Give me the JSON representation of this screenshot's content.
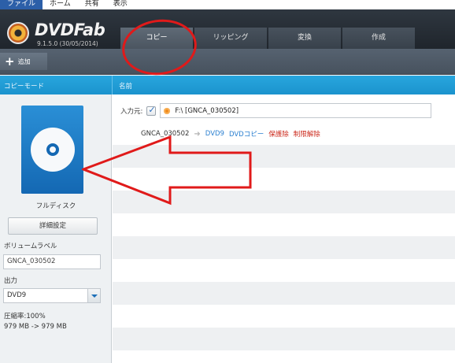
{
  "menu": {
    "items": [
      "ファイル",
      "ホーム",
      "共有",
      "表示"
    ]
  },
  "app": {
    "logo_text": "DVDFab",
    "version": "9.1.5.0 (30/05/2014)"
  },
  "tabs": [
    {
      "label": "コピー",
      "active": true
    },
    {
      "label": "リッピング",
      "active": false
    },
    {
      "label": "変換",
      "active": false
    },
    {
      "label": "作成",
      "active": false
    }
  ],
  "toolbar": {
    "add_label": "追加"
  },
  "bars": {
    "copy_mode_label": "コピーモード",
    "name_header": "名前"
  },
  "left": {
    "mode_name": "フルディスク",
    "settings_button": "詳細設定",
    "volume_label_title": "ボリュームラベル",
    "volume_label_value": "GNCA_030502",
    "output_title": "出力",
    "output_value": "DVD9",
    "compression": "圧縮率:100%",
    "size_info": "979 MB -> 979 MB"
  },
  "main": {
    "source_label": "入力元:",
    "source_value": "F:\\ [GNCA_030502]",
    "title": {
      "name": "GNCA_030502",
      "format": "DVD9",
      "copy_tag": "DVDコピー",
      "note1": "保護除",
      "note2": "制限解除"
    }
  },
  "colors": {
    "accent_blue": "#1b93cd",
    "header_dark": "#2f3740",
    "annotation_red": "#e01a1a"
  }
}
